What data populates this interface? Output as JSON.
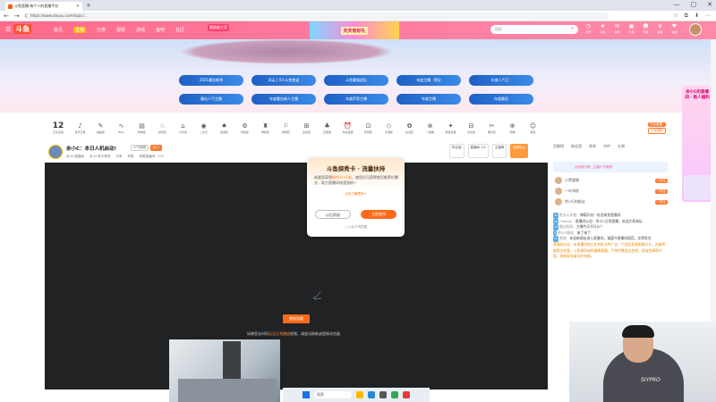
{
  "browser": {
    "tab_title": "斗鱼直播·每个人的直播平台",
    "url": "https://www.douyu.com/topic/...",
    "new_tab_glyph": "+",
    "window_controls": [
      "—",
      "▢",
      "✕"
    ],
    "nav": [
      "←",
      "→",
      "⟳"
    ],
    "tools": [
      "☆",
      "⧉",
      "⬇",
      "⋯"
    ]
  },
  "header": {
    "logo": "斗鱼",
    "menu_glyph": "☰",
    "nav": [
      "首页",
      "直播",
      "分类",
      "视频",
      "游戏",
      "鱼吧",
      "社区"
    ],
    "active_nav": 1,
    "promo_badge": "赢超级大奖",
    "promo_text": "天天有好礼",
    "search_placeholder": "搜索",
    "icons": [
      {
        "glyph": "◷",
        "label": "历史"
      },
      {
        "glyph": "★",
        "label": "关注"
      },
      {
        "glyph": "✉",
        "label": "消息"
      },
      {
        "glyph": "▣",
        "label": "下载"
      },
      {
        "glyph": "☻",
        "label": "开播"
      },
      {
        "glyph": "♛",
        "label": "贵族"
      },
      {
        "glyph": "♥",
        "label": "充值"
      }
    ]
  },
  "banner_tags": [
    {
      "text": "2021最佳新秀"
    },
    {
      "text": "风云 | 03-斗鱼夜谈"
    },
    {
      "text": "斗鱼最强战队"
    },
    {
      "text": "年度主播 · 得分"
    },
    {
      "text": "年度人气王 ·"
    },
    {
      "text": "最佳人气主播"
    },
    {
      "text": "年度最佳新人主播"
    },
    {
      "text": "年度声音主播"
    },
    {
      "text": "年度主播"
    },
    {
      "text": "年度最佳"
    }
  ],
  "category_bar": {
    "count": "12",
    "count_label": "正在直播",
    "items": [
      {
        "glyph": "♪",
        "label": "音乐王者"
      },
      {
        "glyph": "✎",
        "label": "舞蹈区"
      },
      {
        "glyph": "∿",
        "label": "Blink"
      },
      {
        "glyph": "▤",
        "label": "新物区"
      },
      {
        "glyph": "♘",
        "label": "颜值区"
      },
      {
        "glyph": "⌂",
        "label": "户外区"
      },
      {
        "glyph": "◉",
        "label": "二次元"
      },
      {
        "glyph": "♠",
        "label": "桌游区"
      },
      {
        "glyph": "⚙",
        "label": "科技区"
      },
      {
        "glyph": "♜",
        "label": "单机区"
      },
      {
        "glyph": "⚐",
        "label": "网游区"
      },
      {
        "glyph": "⊞",
        "label": "主机区"
      },
      {
        "glyph": "♣",
        "label": "正能量"
      },
      {
        "glyph": "⏰",
        "label": "车友直播"
      },
      {
        "glyph": "⊡",
        "label": "影视区"
      },
      {
        "glyph": "◇",
        "label": "手游区"
      },
      {
        "glyph": "✿",
        "label": "生活区"
      },
      {
        "glyph": "⊗",
        "label": "一起看"
      },
      {
        "glyph": "✦",
        "label": "颜值直播"
      },
      {
        "glyph": "⊟",
        "label": "文化区"
      },
      {
        "glyph": "✂",
        "label": "娱乐区"
      },
      {
        "glyph": "⊕",
        "label": "购物"
      },
      {
        "glyph": "☺",
        "label": "更多"
      }
    ],
    "more_buttons": [
      "开启直播",
      "订阅通知"
    ]
  },
  "room": {
    "title": "余小C：本日人机启动!",
    "tags": [
      "人气视频",
      "热门"
    ],
    "info": [
      "余小C直播间",
      "余小C官方鱼吧",
      "分享",
      "举报",
      "观看直播间：123"
    ],
    "right_boxes": [
      "粉丝团",
      "直播间 1/4",
      "主播榜",
      "活动中心"
    ]
  },
  "player": {
    "button": "重新加载",
    "text_pre": "如果您长时间",
    "text_highlight": "无法正常播放",
    "text_post": "视频，请尝试刷新或更换浏览器"
  },
  "popup": {
    "title": "斗鱼探秀卡 · 流量扶持",
    "body_pre": "恭喜您获得",
    "body_highlight": "探秀卡×1张",
    "body_post": "，使用后可获得首页推荐位曝光，助力直播间快速涨粉~",
    "link": "点击了解更多>",
    "btn_secondary": "以后再说",
    "btn_primary": "立即使用",
    "checkbox": "以后不再提醒"
  },
  "chat": {
    "tabs": [
      "贡献榜",
      "粉丝团",
      "贵宾",
      "守护",
      "礼物"
    ],
    "rank_strip": "全站排行榜 · 主播人气周榜",
    "ranks": [
      {
        "name": "小黑猫猫",
        "badge": "+关注"
      },
      {
        "name": "一叶知秋",
        "badge": "+关注"
      },
      {
        "name": "余小C的粉丝",
        "badge": "+关注"
      }
    ],
    "messages": [
      {
        "level": "30",
        "name": "鱼丸小天使：",
        "text": "弹幕开启！欢迎来到直播间"
      },
      {
        "level": "18",
        "name": "Chenzy：",
        "text": "直播间公告：余小C日常直播，欢迎大家来玩"
      },
      {
        "level": "12",
        "name": "路过的风：",
        "text": "主播今天打什么？"
      },
      {
        "level": "9",
        "name": "余小C粉丝：",
        "text": "来了来了"
      },
      {
        "level": "22",
        "name": "系统：",
        "text": "欢迎新朋友进入直播间，请遵守直播间规范，文明发言"
      }
    ],
    "notice": "直播间公告：本直播间禁止任何形式的广告、引战及恶意刷屏行为，违者将被禁言处理。斗鱼倡导绿色健康直播，严禁传播违法违规、低俗色情等内容，如有发现请及时举报。"
  },
  "ad": {
    "text": "余小C的直播间 · 新人福利"
  },
  "taskbar": {
    "search": "搜索"
  },
  "webcam": {
    "print": "SIYPRO"
  }
}
